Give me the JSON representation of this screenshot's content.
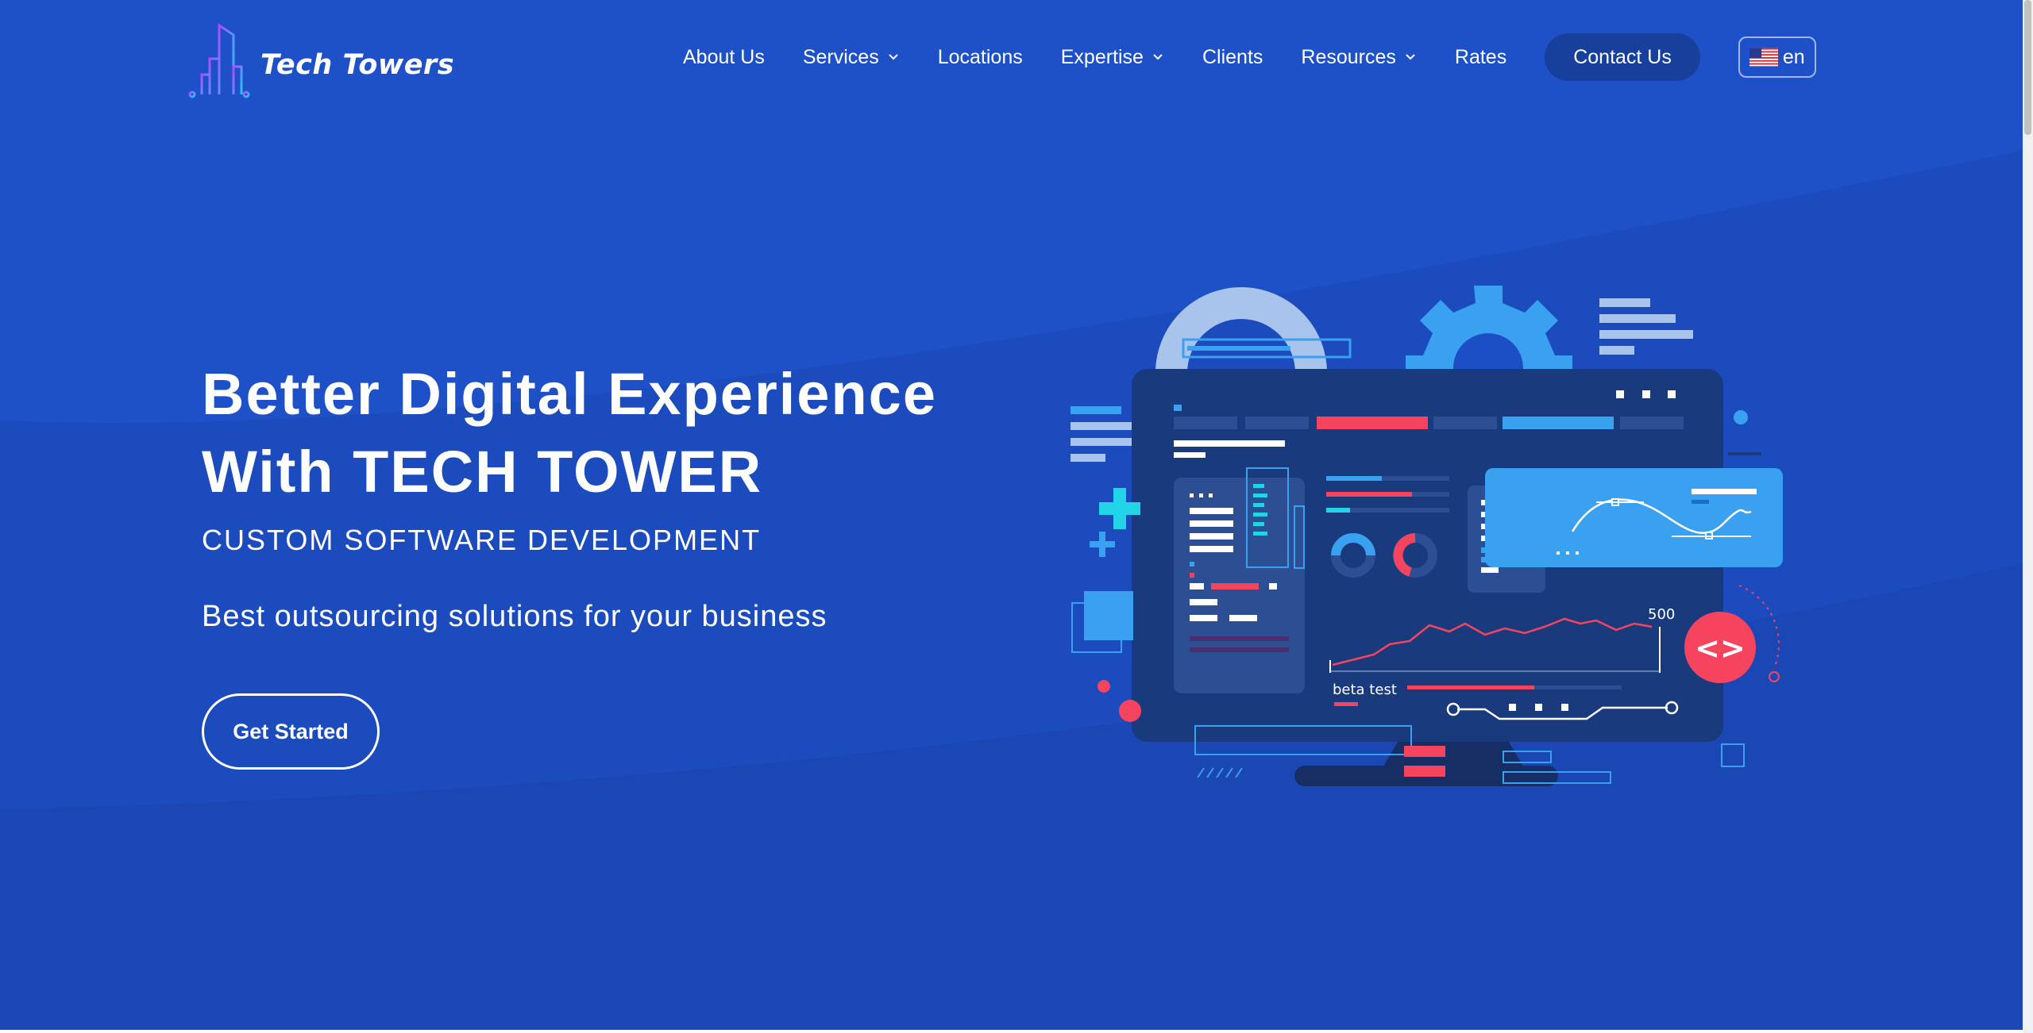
{
  "brand": {
    "name": "Tech Towers"
  },
  "nav": {
    "items": [
      {
        "label": "About Us",
        "has_dropdown": false
      },
      {
        "label": "Services",
        "has_dropdown": true
      },
      {
        "label": "Locations",
        "has_dropdown": false
      },
      {
        "label": "Expertise",
        "has_dropdown": true
      },
      {
        "label": "Clients",
        "has_dropdown": false
      },
      {
        "label": "Resources",
        "has_dropdown": true
      },
      {
        "label": "Rates",
        "has_dropdown": false
      }
    ],
    "contact_label": "Contact Us",
    "language": {
      "label": "en",
      "flag": "us-flag-icon"
    }
  },
  "hero": {
    "headline_line1": "Better Digital Experience",
    "headline_line2": "With TECH TOWER",
    "subtitle": "CUSTOM SOFTWARE DEVELOPMENT",
    "tagline": "Best outsourcing solutions for your business",
    "cta_label": "Get Started"
  },
  "illustration": {
    "chart_value_label": "500",
    "chart_caption": "beta test",
    "code_badge": "<>"
  },
  "colors": {
    "background": "#1e50c8",
    "contact_button": "#173f9c",
    "accent_red": "#f7445e",
    "accent_cyan": "#21d4e8",
    "accent_blue": "#3aa0f0",
    "monitor": "#1a3a7e"
  }
}
